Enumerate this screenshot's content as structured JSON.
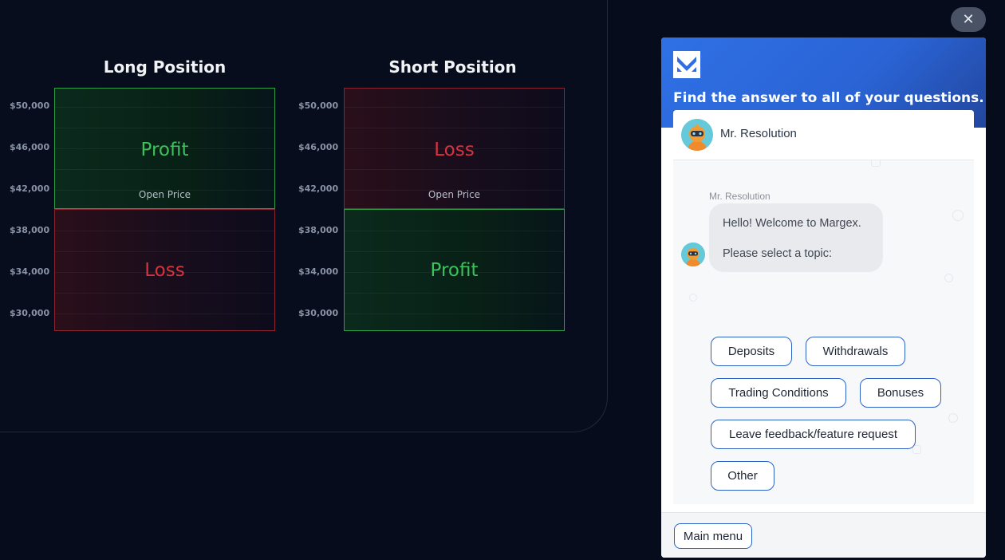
{
  "chart": {
    "long": {
      "title": "Long Position",
      "upper_label": "Profit",
      "lower_label": "Loss",
      "open_price_label": "Open Price"
    },
    "short": {
      "title": "Short Position",
      "upper_label": "Loss",
      "lower_label": "Profit",
      "open_price_label": "Open Price"
    },
    "price_ticks": [
      "$50,000",
      "$46,000",
      "$42,000",
      "$38,000",
      "$34,000",
      "$30,000"
    ],
    "colors": {
      "profit": "#3cc25a",
      "loss": "#d8323f"
    }
  },
  "close_button": {
    "icon": "close-icon",
    "glyph": "✕"
  },
  "chat": {
    "brand": "margex-logo",
    "tagline": "Find the answer to all of your questions.",
    "agent_name": "Mr. Resolution",
    "message": {
      "author": "Mr. Resolution",
      "line1": "Hello! Welcome to Margex.",
      "line2": "Please select a topic:"
    },
    "topics": [
      "Deposits",
      "Withdrawals",
      "Trading Conditions",
      "Bonuses",
      "Leave feedback/feature request",
      "Other"
    ],
    "footer_button": "Main menu",
    "accent_color": "#2f71e6"
  }
}
